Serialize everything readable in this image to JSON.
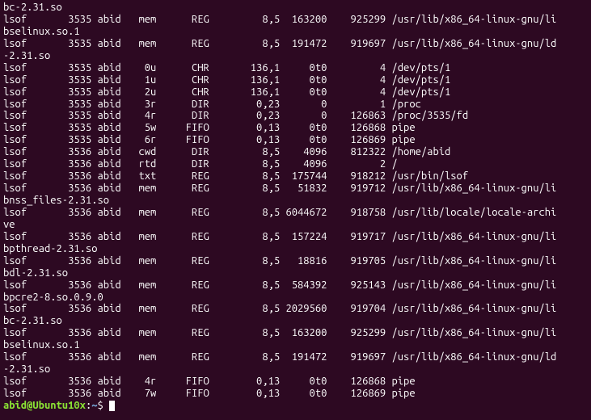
{
  "prompt": {
    "user": "abid",
    "at": "@",
    "host": "Ubuntu10x",
    "colon": ":",
    "path": "~",
    "symbol": "$"
  },
  "lines": [
    {
      "type": "wrap",
      "text": "bc-2.31.so"
    },
    {
      "type": "row",
      "c": [
        "lsof",
        "3535",
        "abid",
        "mem",
        "REG",
        "8,5",
        "163200",
        "925299",
        "/usr/lib/x86_64-linux-gnu/li"
      ]
    },
    {
      "type": "wrap",
      "text": "bselinux.so.1"
    },
    {
      "type": "row",
      "c": [
        "lsof",
        "3535",
        "abid",
        "mem",
        "REG",
        "8,5",
        "191472",
        "919697",
        "/usr/lib/x86_64-linux-gnu/ld"
      ]
    },
    {
      "type": "wrap",
      "text": "-2.31.so"
    },
    {
      "type": "row",
      "c": [
        "lsof",
        "3535",
        "abid",
        "0u",
        "CHR",
        "136,1",
        "0t0",
        "4",
        "/dev/pts/1"
      ]
    },
    {
      "type": "row",
      "c": [
        "lsof",
        "3535",
        "abid",
        "1u",
        "CHR",
        "136,1",
        "0t0",
        "4",
        "/dev/pts/1"
      ]
    },
    {
      "type": "row",
      "c": [
        "lsof",
        "3535",
        "abid",
        "2u",
        "CHR",
        "136,1",
        "0t0",
        "4",
        "/dev/pts/1"
      ]
    },
    {
      "type": "row",
      "c": [
        "lsof",
        "3535",
        "abid",
        "3r",
        "DIR",
        "0,23",
        "0",
        "1",
        "/proc"
      ]
    },
    {
      "type": "row",
      "c": [
        "lsof",
        "3535",
        "abid",
        "4r",
        "DIR",
        "0,23",
        "0",
        "126863",
        "/proc/3535/fd"
      ]
    },
    {
      "type": "row",
      "c": [
        "lsof",
        "3535",
        "abid",
        "5w",
        "FIFO",
        "0,13",
        "0t0",
        "126868",
        "pipe"
      ]
    },
    {
      "type": "row",
      "c": [
        "lsof",
        "3535",
        "abid",
        "6r",
        "FIFO",
        "0,13",
        "0t0",
        "126869",
        "pipe"
      ]
    },
    {
      "type": "row",
      "c": [
        "lsof",
        "3536",
        "abid",
        "cwd",
        "DIR",
        "8,5",
        "4096",
        "812322",
        "/home/abid"
      ]
    },
    {
      "type": "row",
      "c": [
        "lsof",
        "3536",
        "abid",
        "rtd",
        "DIR",
        "8,5",
        "4096",
        "2",
        "/"
      ]
    },
    {
      "type": "row",
      "c": [
        "lsof",
        "3536",
        "abid",
        "txt",
        "REG",
        "8,5",
        "175744",
        "918212",
        "/usr/bin/lsof"
      ]
    },
    {
      "type": "row",
      "c": [
        "lsof",
        "3536",
        "abid",
        "mem",
        "REG",
        "8,5",
        "51832",
        "919712",
        "/usr/lib/x86_64-linux-gnu/li"
      ]
    },
    {
      "type": "wrap",
      "text": "bnss_files-2.31.so"
    },
    {
      "type": "row",
      "c": [
        "lsof",
        "3536",
        "abid",
        "mem",
        "REG",
        "8,5",
        "6044672",
        "918758",
        "/usr/lib/locale/locale-archi"
      ]
    },
    {
      "type": "wrap",
      "text": "ve"
    },
    {
      "type": "row",
      "c": [
        "lsof",
        "3536",
        "abid",
        "mem",
        "REG",
        "8,5",
        "157224",
        "919717",
        "/usr/lib/x86_64-linux-gnu/li"
      ]
    },
    {
      "type": "wrap",
      "text": "bpthread-2.31.so"
    },
    {
      "type": "row",
      "c": [
        "lsof",
        "3536",
        "abid",
        "mem",
        "REG",
        "8,5",
        "18816",
        "919705",
        "/usr/lib/x86_64-linux-gnu/li"
      ]
    },
    {
      "type": "wrap",
      "text": "bdl-2.31.so"
    },
    {
      "type": "row",
      "c": [
        "lsof",
        "3536",
        "abid",
        "mem",
        "REG",
        "8,5",
        "584392",
        "925143",
        "/usr/lib/x86_64-linux-gnu/li"
      ]
    },
    {
      "type": "wrap",
      "text": "bpcre2-8.so.0.9.0"
    },
    {
      "type": "row",
      "c": [
        "lsof",
        "3536",
        "abid",
        "mem",
        "REG",
        "8,5",
        "2029560",
        "919704",
        "/usr/lib/x86_64-linux-gnu/li"
      ]
    },
    {
      "type": "wrap",
      "text": "bc-2.31.so"
    },
    {
      "type": "row",
      "c": [
        "lsof",
        "3536",
        "abid",
        "mem",
        "REG",
        "8,5",
        "163200",
        "925299",
        "/usr/lib/x86_64-linux-gnu/li"
      ]
    },
    {
      "type": "wrap",
      "text": "bselinux.so.1"
    },
    {
      "type": "row",
      "c": [
        "lsof",
        "3536",
        "abid",
        "mem",
        "REG",
        "8,5",
        "191472",
        "919697",
        "/usr/lib/x86_64-linux-gnu/ld"
      ]
    },
    {
      "type": "wrap",
      "text": "-2.31.so"
    },
    {
      "type": "row",
      "c": [
        "lsof",
        "3536",
        "abid",
        "4r",
        "FIFO",
        "0,13",
        "0t0",
        "126868",
        "pipe"
      ]
    },
    {
      "type": "row",
      "c": [
        "lsof",
        "3536",
        "abid",
        "7w",
        "FIFO",
        "0,13",
        "0t0",
        "126869",
        "pipe"
      ]
    }
  ]
}
